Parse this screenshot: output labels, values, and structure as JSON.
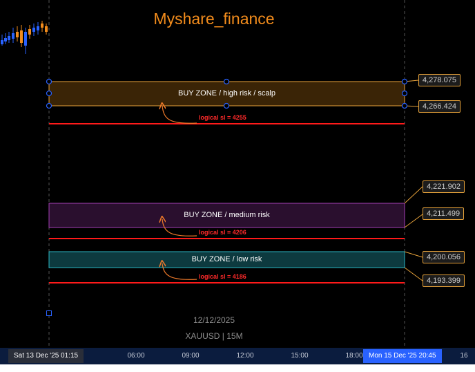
{
  "title": "Myshare_finance",
  "zones": [
    {
      "label": "BUY ZONE / high risk / scalp",
      "top_price": "4,278.075",
      "bottom_price": "4,266.424",
      "sl_label": "logical sl = 4255",
      "fill": "#3a2406",
      "border": "#e8a23c"
    },
    {
      "label": "BUY ZONE / medium risk",
      "top_price": "4,221.902",
      "bottom_price": "4,211.499",
      "sl_label": "logical sl = 4206",
      "fill": "#2a0f2e",
      "border": "#a43fb5"
    },
    {
      "label": "BUY ZONE / low risk",
      "top_price": "4,200.056",
      "bottom_price": "4,193.399",
      "sl_label": "logical sl = 4186",
      "fill": "#0d3a3f",
      "border": "#2ab7c4"
    }
  ],
  "watermark": {
    "date": "12/12/2025",
    "symbol": "XAUUSD | 15M"
  },
  "time_axis": {
    "ticks": [
      "06:00",
      "09:00",
      "12:00",
      "15:00",
      "18:00"
    ],
    "cursor_left": "Sat 13 Dec '25   01:15",
    "cursor_right": "Mon 15 Dec '25   20:45",
    "right_value": "16"
  },
  "colors": {
    "stop_loss": "#ff1a1a",
    "handle": "#2962ff",
    "arrow": "#f07a2a"
  },
  "chart_data": {
    "type": "candlestick",
    "title": "Myshare_finance",
    "symbol": "XAUUSD",
    "interval": "15M",
    "zones": [
      {
        "name": "BUY ZONE / high risk / scalp",
        "top": 4278.075,
        "bottom": 4266.424,
        "stop_loss": 4255
      },
      {
        "name": "BUY ZONE / medium risk",
        "top": 4221.902,
        "bottom": 4211.499,
        "stop_loss": 4206
      },
      {
        "name": "BUY ZONE / low risk",
        "top": 4200.056,
        "bottom": 4193.399,
        "stop_loss": 4186
      }
    ],
    "x_ticks": [
      "06:00",
      "09:00",
      "12:00",
      "15:00",
      "18:00"
    ]
  }
}
